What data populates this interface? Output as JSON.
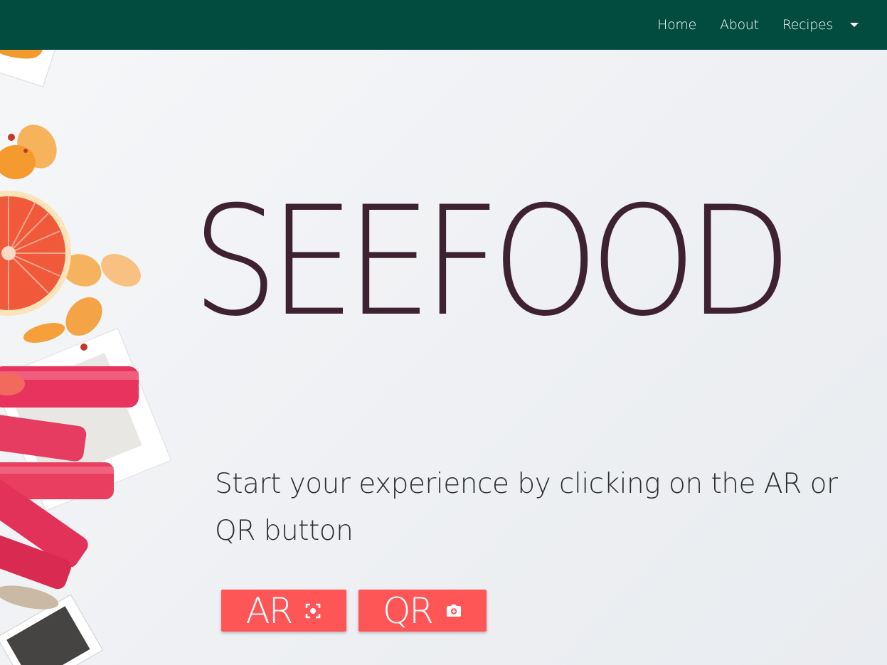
{
  "navbar": {
    "links": [
      {
        "label": "Home"
      },
      {
        "label": "About"
      },
      {
        "label": "Recipes"
      }
    ],
    "dropdown_icon": "caret-down-icon",
    "background_color": "#024b3f"
  },
  "hero": {
    "title": "SEEFOOD",
    "subtitle": "Start your experience by clicking on the AR or QR button",
    "title_color": "#3f2232"
  },
  "actions": {
    "ar": {
      "label": "AR",
      "icon": "center-focus-icon"
    },
    "qr": {
      "label": "QR",
      "icon": "camera-icon"
    },
    "button_color": "#fe5557"
  }
}
